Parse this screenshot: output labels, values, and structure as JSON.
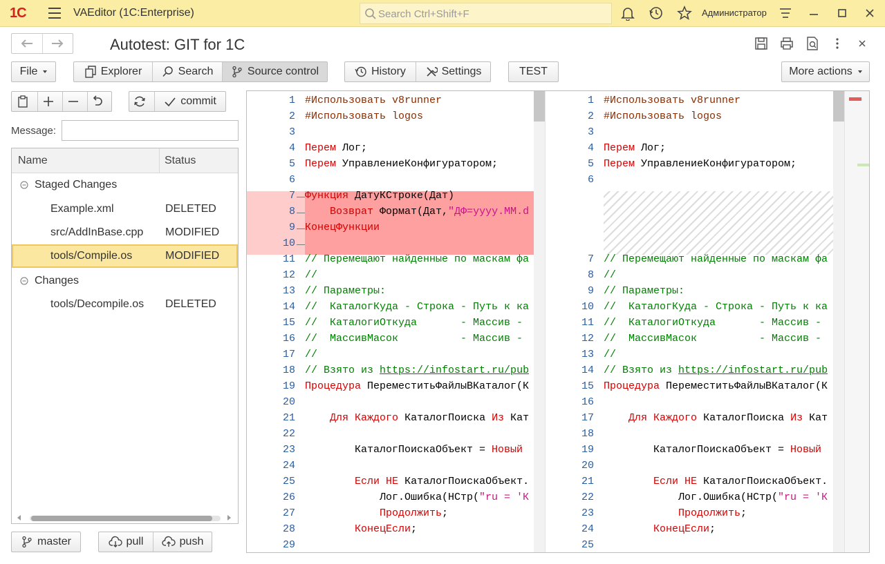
{
  "app": {
    "logo": "1С",
    "title": "VAEditor  (1C:Enterprise)",
    "search_placeholder": "Search Ctrl+Shift+F",
    "user": "Администратор"
  },
  "page": {
    "title": "Autotest: GIT for 1C"
  },
  "toolbar": {
    "file": "File",
    "explorer": "Explorer",
    "search": "Search",
    "source_control": "Source control",
    "history": "History",
    "settings": "Settings",
    "test": "TEST",
    "more_actions": "More actions"
  },
  "scm": {
    "commit": "commit",
    "message_label": "Message:",
    "message_value": "",
    "columns": [
      "Name",
      "Status"
    ],
    "groups": [
      {
        "name": "Staged Changes",
        "items": [
          {
            "name": "Example.xml",
            "status": "DELETED"
          },
          {
            "name": "src/AddInBase.cpp",
            "status": "MODIFIED"
          },
          {
            "name": "tools/Compile.os",
            "status": "MODIFIED",
            "selected": true
          }
        ]
      },
      {
        "name": "Changes",
        "items": [
          {
            "name": "tools/Decompile.os",
            "status": "DELETED"
          }
        ]
      }
    ],
    "branch": "master",
    "pull": "pull",
    "push": "push"
  },
  "diff": {
    "left": [
      {
        "n": "1",
        "t": [
          [
            "#Использовать v8runner",
            "str2"
          ]
        ]
      },
      {
        "n": "2",
        "t": [
          [
            "#Использовать logos",
            "str2"
          ]
        ]
      },
      {
        "n": "3",
        "t": []
      },
      {
        "n": "4",
        "t": [
          [
            "Перем",
            "kw"
          ],
          [
            " Лог;",
            ""
          ]
        ]
      },
      {
        "n": "5",
        "t": [
          [
            "Перем",
            "kw"
          ],
          [
            " УправлениеКонфигуратором;",
            ""
          ]
        ]
      },
      {
        "n": "6",
        "t": []
      },
      {
        "n": "7",
        "t": [
          [
            "Функция",
            "kw"
          ],
          [
            " ДатуКСтроке(Дат)",
            ""
          ]
        ],
        "del": true
      },
      {
        "n": "8",
        "t": [
          [
            "    ",
            ""
          ],
          [
            "Возврат",
            "kw"
          ],
          [
            " Формат(Дат,",
            ""
          ],
          [
            "\"ДФ=yyyy.MM.d",
            "str"
          ]
        ],
        "del": true
      },
      {
        "n": "9",
        "t": [
          [
            "КонецФункции",
            "kw"
          ]
        ],
        "del": true
      },
      {
        "n": "10",
        "t": [],
        "del": true
      },
      {
        "n": "11",
        "t": [
          [
            "// Перемещают найденные по маскам фа",
            "cm"
          ]
        ]
      },
      {
        "n": "12",
        "t": [
          [
            "//",
            "cm"
          ]
        ]
      },
      {
        "n": "13",
        "t": [
          [
            "// Параметры:",
            "cm"
          ]
        ]
      },
      {
        "n": "14",
        "t": [
          [
            "//  КаталогКуда - Строка - Путь к ка",
            "cm"
          ]
        ]
      },
      {
        "n": "15",
        "t": [
          [
            "//  КаталогиОткуда       - Массив -",
            "cm"
          ]
        ]
      },
      {
        "n": "16",
        "t": [
          [
            "//  МассивМасок          - Массив -",
            "cm"
          ]
        ]
      },
      {
        "n": "17",
        "t": [
          [
            "//",
            "cm"
          ]
        ]
      },
      {
        "n": "18",
        "t": [
          [
            "// Взято из ",
            "cm"
          ],
          [
            "https://infostart.ru/pub",
            "lnk"
          ]
        ]
      },
      {
        "n": "19",
        "t": [
          [
            "Процедура",
            "kw"
          ],
          [
            " ПереместитьФайлыВКаталог(К",
            ""
          ]
        ]
      },
      {
        "n": "20",
        "t": []
      },
      {
        "n": "21",
        "t": [
          [
            "    ",
            ""
          ],
          [
            "Для",
            "kw"
          ],
          [
            " ",
            ""
          ],
          [
            "Каждого",
            "kw"
          ],
          [
            " КаталогПоиска ",
            ""
          ],
          [
            "Из",
            "kw"
          ],
          [
            " Кат",
            ""
          ]
        ]
      },
      {
        "n": "22",
        "t": []
      },
      {
        "n": "23",
        "t": [
          [
            "        КаталогПоискаОбъект = ",
            ""
          ],
          [
            "Новый",
            "kw"
          ]
        ]
      },
      {
        "n": "24",
        "t": []
      },
      {
        "n": "25",
        "t": [
          [
            "        ",
            ""
          ],
          [
            "Если",
            "kw"
          ],
          [
            " ",
            ""
          ],
          [
            "НЕ",
            "kw"
          ],
          [
            " КаталогПоискаОбъект.",
            ""
          ]
        ]
      },
      {
        "n": "26",
        "t": [
          [
            "            Лог.Ошибка(НСтр(",
            ""
          ],
          [
            "\"ru = 'К",
            "str"
          ]
        ]
      },
      {
        "n": "27",
        "t": [
          [
            "            ",
            ""
          ],
          [
            "Продолжить",
            "kw"
          ],
          [
            ";",
            ""
          ]
        ]
      },
      {
        "n": "28",
        "t": [
          [
            "        ",
            ""
          ],
          [
            "КонецЕсли",
            "kw"
          ],
          [
            ";",
            ""
          ]
        ]
      },
      {
        "n": "29",
        "t": []
      }
    ],
    "right": [
      {
        "n": "1",
        "t": [
          [
            "#Использовать v8runner",
            "str2"
          ]
        ]
      },
      {
        "n": "2",
        "t": [
          [
            "#Использовать logos",
            "str2"
          ]
        ]
      },
      {
        "n": "3",
        "t": []
      },
      {
        "n": "4",
        "t": [
          [
            "Перем",
            "kw"
          ],
          [
            " Лог;",
            ""
          ]
        ]
      },
      {
        "n": "5",
        "t": [
          [
            "Перем",
            "kw"
          ],
          [
            " УправлениеКонфигуратором;",
            ""
          ]
        ]
      },
      {
        "n": "6",
        "t": []
      },
      {
        "n": "",
        "t": [],
        "gap": true
      },
      {
        "n": "",
        "t": [],
        "gap": true
      },
      {
        "n": "",
        "t": [],
        "gap": true
      },
      {
        "n": "",
        "t": [],
        "gap": true
      },
      {
        "n": "7",
        "t": [
          [
            "// Перемещают найденные по маскам фа",
            "cm"
          ]
        ]
      },
      {
        "n": "8",
        "t": [
          [
            "//",
            "cm"
          ]
        ]
      },
      {
        "n": "9",
        "t": [
          [
            "// Параметры:",
            "cm"
          ]
        ]
      },
      {
        "n": "10",
        "t": [
          [
            "//  КаталогКуда - Строка - Путь к ка",
            "cm"
          ]
        ]
      },
      {
        "n": "11",
        "t": [
          [
            "//  КаталогиОткуда       - Массив -",
            "cm"
          ]
        ]
      },
      {
        "n": "12",
        "t": [
          [
            "//  МассивМасок          - Массив -",
            "cm"
          ]
        ]
      },
      {
        "n": "13",
        "t": [
          [
            "//",
            "cm"
          ]
        ]
      },
      {
        "n": "14",
        "t": [
          [
            "// Взято из ",
            "cm"
          ],
          [
            "https://infostart.ru/pub",
            "lnk"
          ]
        ]
      },
      {
        "n": "15",
        "t": [
          [
            "Процедура",
            "kw"
          ],
          [
            " ПереместитьФайлыВКаталог(К",
            ""
          ]
        ]
      },
      {
        "n": "16",
        "t": []
      },
      {
        "n": "17",
        "t": [
          [
            "    ",
            ""
          ],
          [
            "Для",
            "kw"
          ],
          [
            " ",
            ""
          ],
          [
            "Каждого",
            "kw"
          ],
          [
            " КаталогПоиска ",
            ""
          ],
          [
            "Из",
            "kw"
          ],
          [
            " Кат",
            ""
          ]
        ]
      },
      {
        "n": "18",
        "t": []
      },
      {
        "n": "19",
        "t": [
          [
            "        КаталогПоискаОбъект = ",
            ""
          ],
          [
            "Новый",
            "kw"
          ]
        ]
      },
      {
        "n": "20",
        "t": []
      },
      {
        "n": "21",
        "t": [
          [
            "        ",
            ""
          ],
          [
            "Если",
            "kw"
          ],
          [
            " ",
            ""
          ],
          [
            "НЕ",
            "kw"
          ],
          [
            " КаталогПоискаОбъект.",
            ""
          ]
        ]
      },
      {
        "n": "22",
        "t": [
          [
            "            Лог.Ошибка(НСтр(",
            ""
          ],
          [
            "\"ru = 'К",
            "str"
          ]
        ]
      },
      {
        "n": "23",
        "t": [
          [
            "            ",
            ""
          ],
          [
            "Продолжить",
            "kw"
          ],
          [
            ";",
            ""
          ]
        ]
      },
      {
        "n": "24",
        "t": [
          [
            "        ",
            ""
          ],
          [
            "КонецЕсли",
            "kw"
          ],
          [
            ";",
            ""
          ]
        ]
      },
      {
        "n": "25",
        "t": []
      }
    ]
  },
  "colors": {
    "titlebar": "#fbeda3",
    "deleted_band": "#ffa0a0",
    "selected_row": "#fbe7a0",
    "keyword": "#d40000",
    "comment": "#008000",
    "line_number": "#2a5d9f"
  }
}
